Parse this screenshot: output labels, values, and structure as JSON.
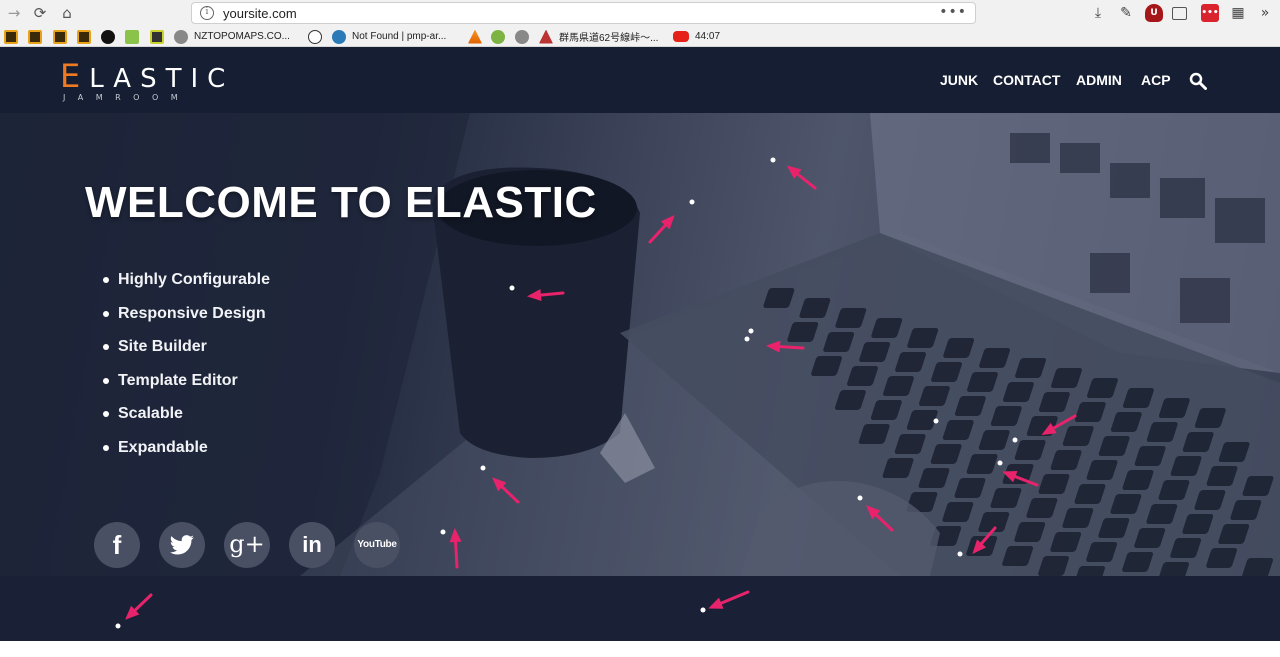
{
  "browser": {
    "url": "yoursite.com",
    "nav": {
      "back_icon": "arrow-right-icon",
      "reload_icon": "reload-icon",
      "home_icon": "home-icon"
    },
    "bookmarks": [
      {
        "label": "NZTOPOMAPS.CO..."
      },
      {
        "label": "Not Found | pmp-ar..."
      },
      {
        "label": "群馬県道62号線峠〜..."
      },
      {
        "label": "44:07"
      }
    ]
  },
  "site": {
    "logo": {
      "main": "LASTIC",
      "initial": "E",
      "sub": "JAMROOM"
    },
    "menu": [
      "JUNK",
      "CONTACT",
      "ADMIN",
      "ACP"
    ],
    "hero": {
      "title": "WELCOME TO ELASTIC",
      "features": [
        "Highly Configurable",
        "Responsive Design",
        "Site Builder",
        "Template Editor",
        "Scalable",
        "Expandable"
      ]
    },
    "social": [
      {
        "name": "facebook",
        "glyph": "f"
      },
      {
        "name": "twitter",
        "glyph": ""
      },
      {
        "name": "google-plus",
        "glyph": "g+"
      },
      {
        "name": "linkedin",
        "glyph": "in"
      },
      {
        "name": "youtube",
        "glyph": "YouTube"
      }
    ],
    "colors": {
      "accent": "#f07a22",
      "header_bg": "#161e33",
      "arrow": "#e8236b"
    }
  }
}
